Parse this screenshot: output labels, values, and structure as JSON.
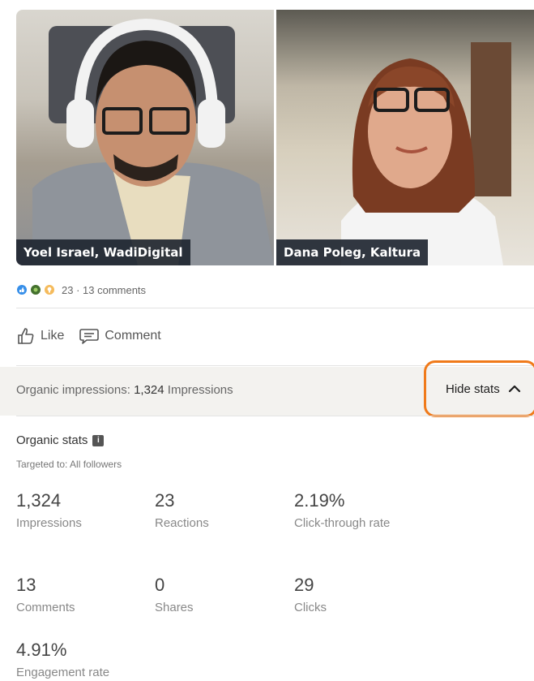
{
  "video": {
    "left_name": "Yoel Israel, WadiDigital",
    "right_name": "Dana Poleg, Kaltura"
  },
  "social": {
    "reaction_icons": [
      "like-icon",
      "celebrate-icon",
      "insightful-icon"
    ],
    "reactions_text": "23 · 13 comments",
    "like_label": "Like",
    "comment_label": "Comment"
  },
  "stats_bar": {
    "impressions_prefix": "Organic impressions:",
    "impressions_value": "1,324",
    "impressions_suffix": "Impressions",
    "hide_label": "Hide stats"
  },
  "organic": {
    "title": "Organic stats",
    "info_glyph": "i",
    "targeted": "Targeted to: All followers",
    "metrics": [
      {
        "value": "1,324",
        "label": "Impressions"
      },
      {
        "value": "23",
        "label": "Reactions"
      },
      {
        "value": "2.19%",
        "label": "Click-through rate"
      },
      {
        "value": "13",
        "label": "Comments"
      },
      {
        "value": "0",
        "label": "Shares"
      },
      {
        "value": "29",
        "label": "Clicks"
      },
      {
        "value": "4.91%",
        "label": "Engagement rate"
      }
    ]
  },
  "colors": {
    "highlight": "#f07a1a",
    "like": "#378fe9",
    "celebrate": "#44712e",
    "insight": "#f5bb5c"
  }
}
